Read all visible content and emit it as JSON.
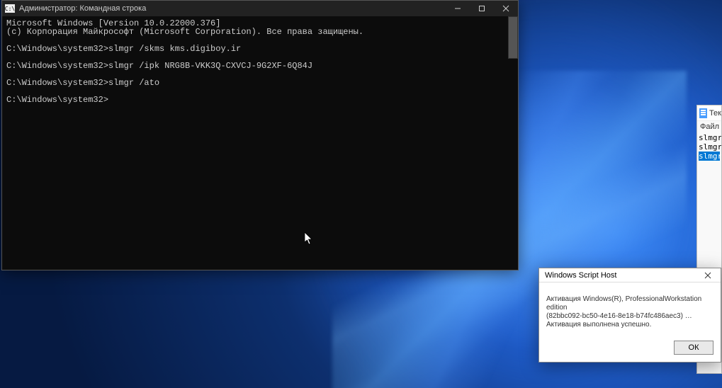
{
  "cmd": {
    "title": "Администратор: Командная строка",
    "lines": {
      "l1": "Microsoft Windows [Version 10.0.22000.376]",
      "l2": "(c) Корпорация Майкрософт (Microsoft Corporation). Все права защищены.",
      "l3": "",
      "l4": "C:\\Windows\\system32>slmgr /skms kms.digiboy.ir",
      "l5": "",
      "l6": "C:\\Windows\\system32>slmgr /ipk NRG8B-VKK3Q-CXVCJ-9G2XF-6Q84J",
      "l7": "",
      "l8": "C:\\Windows\\system32>slmgr /ato",
      "l9": "",
      "l10": "C:\\Windows\\system32>"
    }
  },
  "notepad": {
    "title_fragment": "Тек",
    "menu_file": "Файл",
    "lines": {
      "l1": "slmgr",
      "l2": "slmgr",
      "l3": "slmgr"
    }
  },
  "dialog": {
    "title": "Windows Script Host",
    "body_line1": "Активация Windows(R), ProfessionalWorkstation edition",
    "body_line2": "(82bbc092-bc50-4e16-8e18-b74fc486aec3) …",
    "body_line3": "Активация выполнена успешно.",
    "ok_label": "ОК"
  }
}
